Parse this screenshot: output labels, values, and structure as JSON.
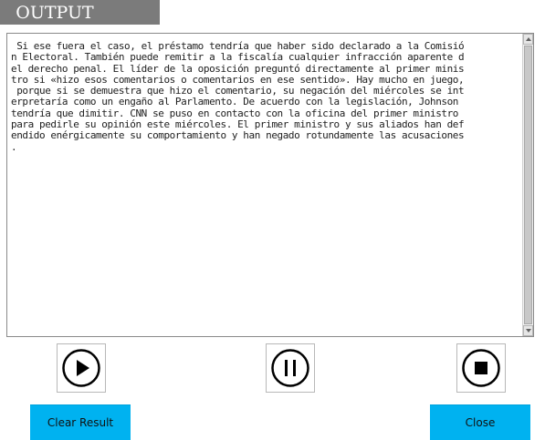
{
  "header": {
    "title": "OUTPUT"
  },
  "output": {
    "lines": [
      " Si ese fuera el caso, el préstamo tendría que haber sido declarado a la Comisió",
      "n Electoral. También puede remitir a la fiscalía cualquier infracción aparente d",
      "el derecho penal. El líder de la oposición preguntó directamente al primer minis",
      "tro si «hizo esos comentarios o comentarios en ese sentido». Hay mucho en juego,",
      " porque si se demuestra que hizo el comentario, su negación del miércoles se int",
      "erpretaría como un engaño al Parlamento. De acuerdo con la legislación, Johnson ",
      "tendría que dimitir. CNN se puso en contacto con la oficina del primer ministro ",
      "para pedirle su opinión este miércoles. El primer ministro y sus aliados han def",
      "endido enérgicamente su comportamiento y han negado rotundamente las acusaciones",
      "."
    ]
  },
  "controls": {
    "play_icon": "play-icon",
    "pause_icon": "pause-icon",
    "stop_icon": "stop-icon"
  },
  "buttons": {
    "clear_result": "Clear Result",
    "close": "Close"
  },
  "colors": {
    "title_bg": "#7b7b7b",
    "button_bg": "#00b2f0"
  }
}
